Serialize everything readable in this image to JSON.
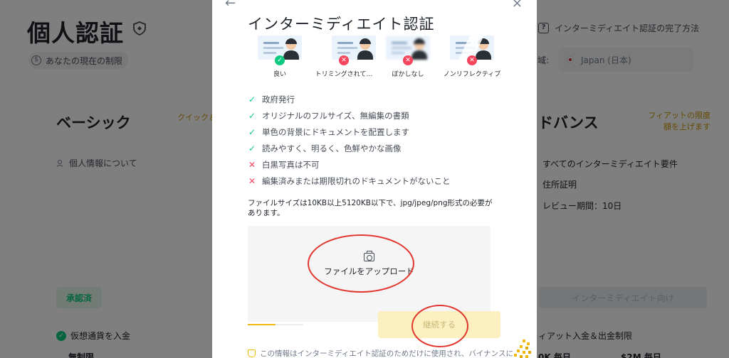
{
  "background": {
    "page_title": "個人認証",
    "limit_chip": "あなたの現在の制限",
    "basic": {
      "title": "ベーシック",
      "tag": "クイック＆",
      "personal_info": "個人情報について",
      "approved": "承認済",
      "crypto_deposit": "仮想通貨を入金",
      "unlimited": "無制限"
    },
    "help_link": "インターミディエイト認証の完了方法",
    "region_label": "域:",
    "region_value": "Japan (日本)",
    "advanced": {
      "title": "ドバンス",
      "tag": "フィアットの限度額を上げます",
      "requirements": [
        "すべてのインターミディエイト要件",
        "住所証明",
        "レビュー期間：10日"
      ],
      "button": "インターミディエイト向け",
      "fiat_limits": "ィアット入金＆出金制限",
      "limit_a": "0K 毎日",
      "limit_b": "$2M 毎日"
    },
    "colors": {
      "accent": "#f0b90b",
      "success": "#0ecb81",
      "error": "#f6465d"
    }
  },
  "modal": {
    "back_icon": "←",
    "close_icon": "×",
    "title": "インターミディエイト認証",
    "samples": [
      {
        "label": "良い",
        "status": "✓"
      },
      {
        "label": "トリミングされて…",
        "status": "✕"
      },
      {
        "label": "ぼかしなし",
        "status": "✕"
      },
      {
        "label": "ノンリフレクティブ",
        "status": "✕"
      }
    ],
    "requirements": [
      {
        "mark": "✓",
        "ok": true,
        "text": "政府発行"
      },
      {
        "mark": "✓",
        "ok": true,
        "text": "オリジナルのフルサイズ、無編集の書類"
      },
      {
        "mark": "✓",
        "ok": true,
        "text": "単色の背景にドキュメントを配置します"
      },
      {
        "mark": "✓",
        "ok": true,
        "text": "読みやすく、明るく、色鮮やかな画像"
      },
      {
        "mark": "✕",
        "ok": false,
        "text": "白黒写真は不可"
      },
      {
        "mark": "✕",
        "ok": false,
        "text": "編集済みまたは期限切れのドキュメントがないこと"
      }
    ],
    "file_note": "ファイルサイズは10KB以上5120KB以下で、jpg/jpeg/png形式の必要があります。",
    "upload_label": "ファイルをアップロード",
    "progress_fraction": 0.5,
    "continue_label": "継続する",
    "privacy_note": "この情報はインターミディエイト認証のためだけに使用され、バイナンスに"
  }
}
